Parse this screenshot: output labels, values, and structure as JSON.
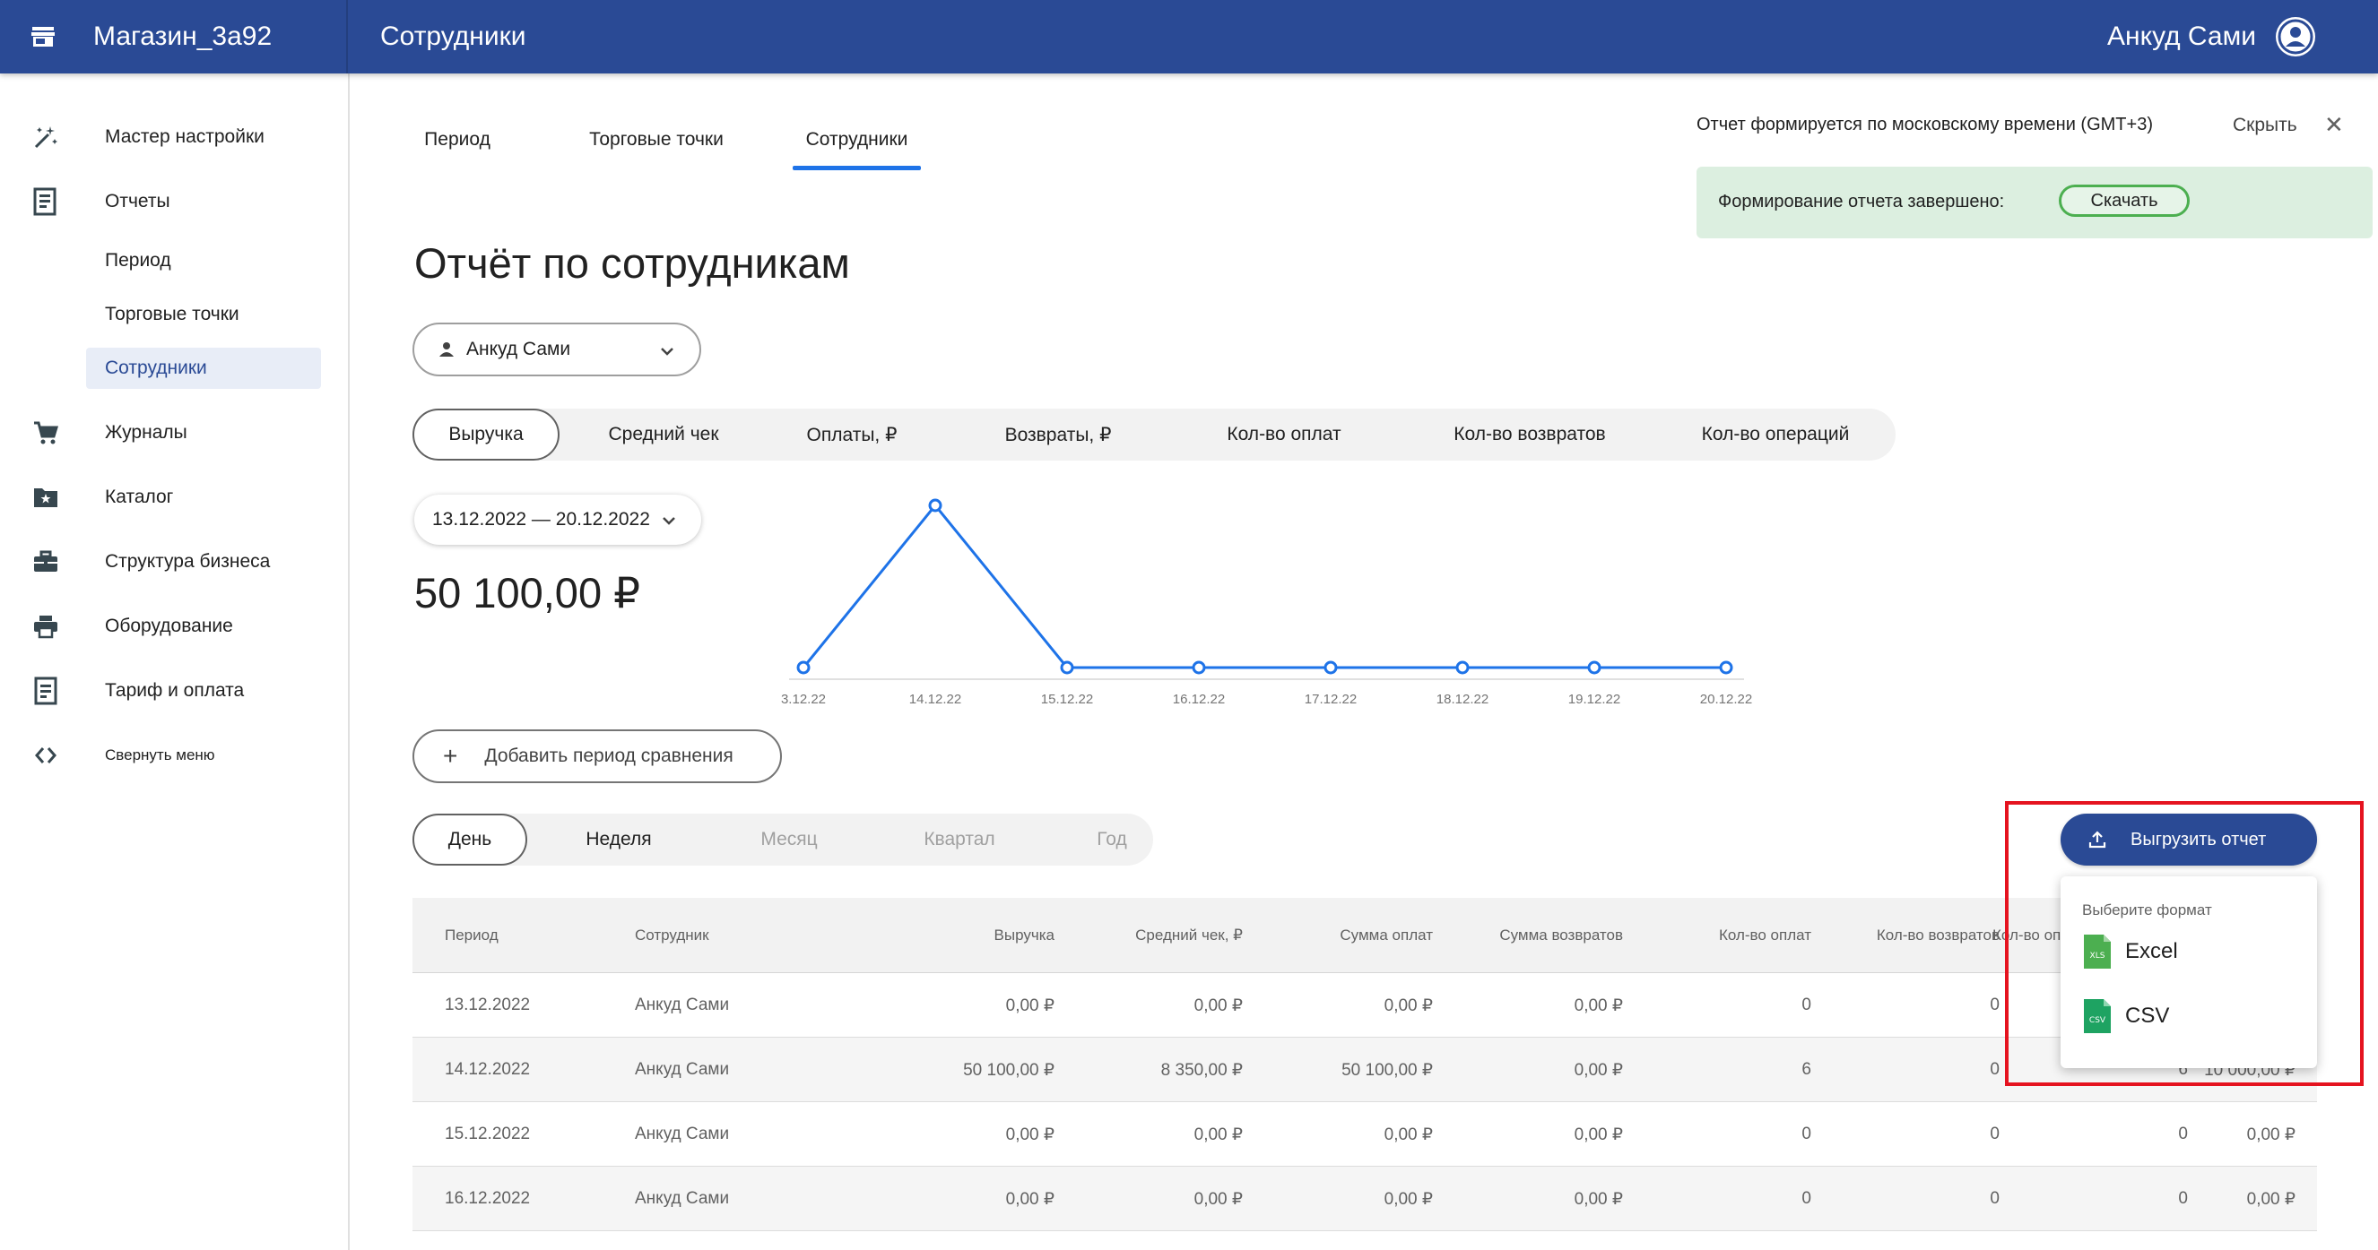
{
  "header": {
    "shop_name": "Магазин_3а92",
    "page_title": "Сотрудники",
    "user_name": "Анкуд Сами"
  },
  "sidebar": {
    "items": [
      {
        "label": "Мастер настройки",
        "icon": "magic-wand-icon"
      },
      {
        "label": "Отчеты",
        "icon": "report-icon"
      },
      {
        "label": "Журналы",
        "icon": "cart-icon"
      },
      {
        "label": "Каталог",
        "icon": "folder-star-icon"
      },
      {
        "label": "Структура бизнеса",
        "icon": "briefcase-icon"
      },
      {
        "label": "Оборудование",
        "icon": "printer-icon"
      },
      {
        "label": "Тариф и оплата",
        "icon": "receipt-icon"
      },
      {
        "label": "Свернуть меню",
        "icon": "collapse-icon"
      }
    ],
    "report_subitems": [
      "Период",
      "Торговые точки",
      "Сотрудники"
    ],
    "active_subitem": "Сотрудники"
  },
  "tabs": [
    "Период",
    "Торговые точки",
    "Сотрудники"
  ],
  "active_tab": "Сотрудники",
  "notice": {
    "text": "Отчет формируется по московскому времени (GMT+3)",
    "hide": "Скрыть",
    "success_text": "Формирование отчета завершено:",
    "download": "Скачать"
  },
  "report_title": "Отчёт по сотрудникам",
  "employee_select": "Анкуд Сами",
  "metrics": [
    "Выручка",
    "Средний чек",
    "Оплаты, ₽",
    "Возвраты, ₽",
    "Кол-во оплат",
    "Кол-во возвратов",
    "Кол-во операций"
  ],
  "active_metric": "Выручка",
  "date_range": "13.12.2022 — 20.12.2022",
  "big_value": "50 100,00 ₽",
  "chart_data": {
    "type": "line",
    "categories": [
      "3.12.22",
      "14.12.22",
      "15.12.22",
      "16.12.22",
      "17.12.22",
      "18.12.22",
      "19.12.22",
      "20.12.22"
    ],
    "series": [
      {
        "values": [
          0,
          50100,
          0,
          0,
          0,
          0,
          0,
          0
        ]
      }
    ],
    "color": "#1e73e8"
  },
  "compare_button": "Добавить период сравнения",
  "periods": [
    "День",
    "Неделя",
    "Месяц",
    "Квартал",
    "Год"
  ],
  "active_period": "День",
  "export": {
    "button": "Выгрузить отчет",
    "dropdown_title": "Выберите формат",
    "formats": [
      {
        "label": "Excel",
        "badge": "XLS",
        "color": "#4caf50"
      },
      {
        "label": "CSV",
        "badge": "CSV",
        "color": "#1ea362"
      }
    ]
  },
  "table": {
    "headers": [
      "Период",
      "Сотрудник",
      "Выручка",
      "Средний чек, ₽",
      "Сумма оплат",
      "Сумма возвратов",
      "Кол-во оплат",
      "Кол-во возвратов",
      "Кол-во оп",
      ""
    ],
    "rows": [
      [
        "13.12.2022",
        "Анкуд Сами",
        "0,00 ₽",
        "0,00 ₽",
        "0,00 ₽",
        "0,00 ₽",
        "0",
        "0",
        "",
        ""
      ],
      [
        "14.12.2022",
        "Анкуд Сами",
        "50 100,00 ₽",
        "8 350,00 ₽",
        "50 100,00 ₽",
        "0,00 ₽",
        "6",
        "0",
        "6",
        "10 000,00 ₽"
      ],
      [
        "15.12.2022",
        "Анкуд Сами",
        "0,00 ₽",
        "0,00 ₽",
        "0,00 ₽",
        "0,00 ₽",
        "0",
        "0",
        "0",
        "0,00 ₽"
      ],
      [
        "16.12.2022",
        "Анкуд Сами",
        "0,00 ₽",
        "0,00 ₽",
        "0,00 ₽",
        "0,00 ₽",
        "0",
        "0",
        "0",
        "0,00 ₽"
      ]
    ]
  }
}
